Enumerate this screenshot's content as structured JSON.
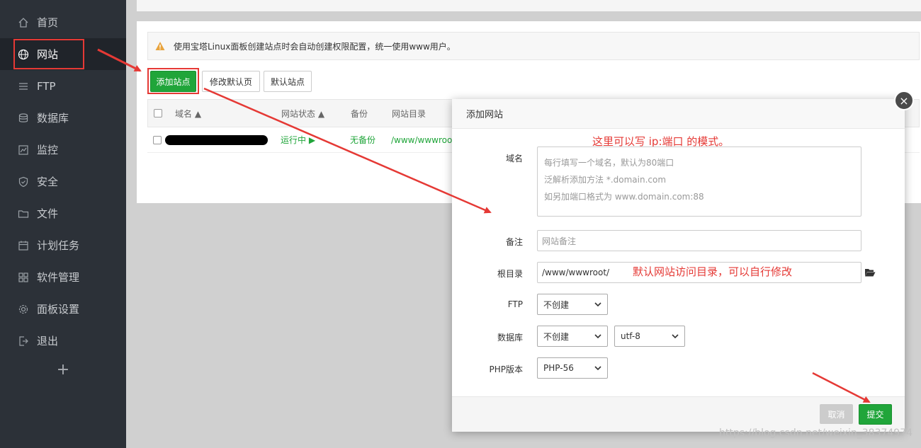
{
  "sidebar": {
    "items": [
      {
        "label": "首页",
        "icon": "home-icon"
      },
      {
        "label": "网站",
        "icon": "globe-icon",
        "active": true
      },
      {
        "label": "FTP",
        "icon": "ftp-icon"
      },
      {
        "label": "数据库",
        "icon": "database-icon"
      },
      {
        "label": "监控",
        "icon": "monitor-icon"
      },
      {
        "label": "安全",
        "icon": "shield-icon"
      },
      {
        "label": "文件",
        "icon": "folder-icon"
      },
      {
        "label": "计划任务",
        "icon": "calendar-icon"
      },
      {
        "label": "软件管理",
        "icon": "apps-icon"
      },
      {
        "label": "面板设置",
        "icon": "gear-icon"
      },
      {
        "label": "退出",
        "icon": "logout-icon"
      }
    ],
    "plus": "+"
  },
  "notice": "使用宝塔Linux面板创建站点时会自动创建权限配置，统一使用www用户。",
  "toolbar": {
    "add_site": "添加站点",
    "edit_default_page": "修改默认页",
    "default_site": "默认站点"
  },
  "table": {
    "columns": [
      "域名 ▲",
      "网站状态 ▲",
      "备份",
      "网站目录"
    ],
    "rows": [
      {
        "status": "运行中 ▶",
        "backup": "无备份",
        "dir": "/www/wwwroo"
      }
    ]
  },
  "dialog": {
    "title": "添加网站",
    "close": "×",
    "domain_label": "域名",
    "domain_placeholder": [
      "每行填写一个域名，默认为80端口",
      "泛解析添加方法 *.domain.com",
      "如另加端口格式为 www.domain.com:88"
    ],
    "note_label": "备注",
    "note_placeholder": "网站备注",
    "root_label": "根目录",
    "root_value": "/www/wwwroot/",
    "ftp_label": "FTP",
    "ftp_value": "不创建",
    "db_label": "数据库",
    "db_value": "不创建",
    "db_charset": "utf-8",
    "php_label": "PHP版本",
    "php_value": "PHP-56",
    "cancel": "取消",
    "submit": "提交"
  },
  "annotations": {
    "domain_hint": "这里可以写 ip:端口 的模式。",
    "root_hint": "默认网站访问目录，可以自行修改"
  },
  "watermark": "https://blog.csdn.net/weixin_38374974",
  "colors": {
    "sidebar_bg": "#2c3138",
    "accent_green": "#20a53a",
    "annotation_red": "#e53935",
    "warning_orange": "#e8a33d"
  }
}
